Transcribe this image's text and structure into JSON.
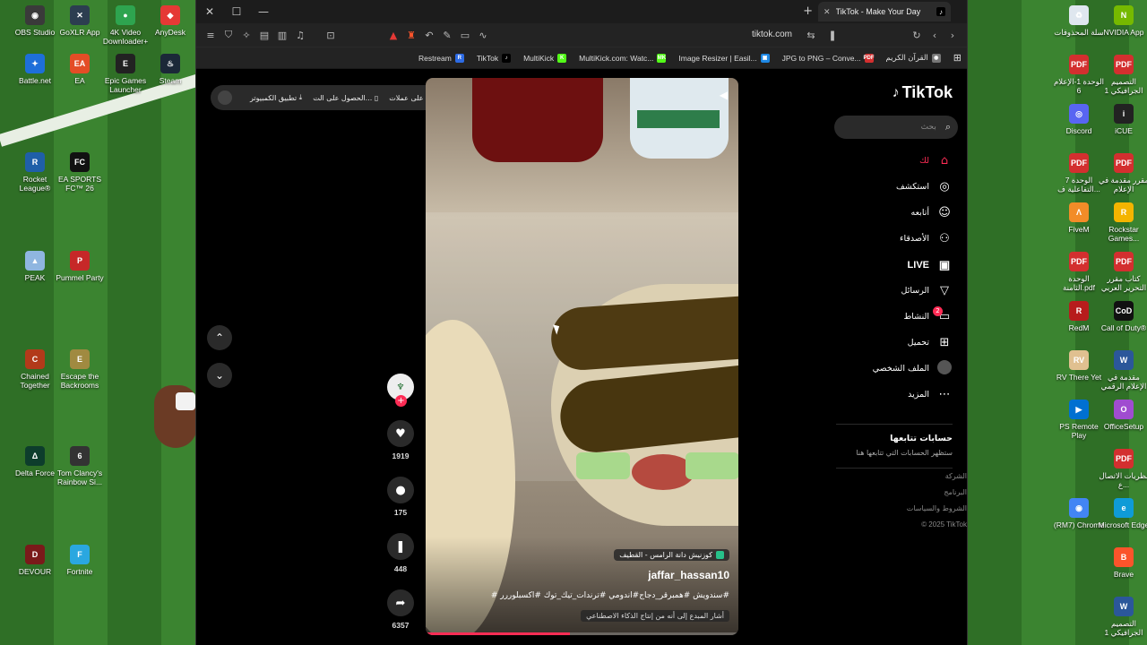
{
  "desktop": {
    "left_icons": [
      {
        "label": "OBS Studio",
        "name": "obs-studio-icon",
        "color": "#3a3a3a",
        "glyph": "◉"
      },
      {
        "label": "GoXLR App",
        "name": "goxlr-icon",
        "color": "#2c3e50",
        "glyph": "✕"
      },
      {
        "label": "4K Video Downloader+",
        "name": "4k-video-downloader-icon",
        "color": "#2ea44f",
        "glyph": "●"
      },
      {
        "label": "AnyDesk",
        "name": "anydesk-icon",
        "color": "#e53935",
        "glyph": "◆"
      },
      {
        "label": "Battle.net",
        "name": "battlenet-icon",
        "color": "#1e6fd9",
        "glyph": "✦"
      },
      {
        "label": "EA",
        "name": "ea-icon",
        "color": "#e44d26",
        "glyph": "EA"
      },
      {
        "label": "Epic Games Launcher",
        "name": "epic-games-icon",
        "color": "#222",
        "glyph": "E"
      },
      {
        "label": "Steam",
        "name": "steam-icon",
        "color": "#1b2838",
        "glyph": "♨"
      },
      {
        "label": "Rocket League®",
        "name": "rocket-league-icon",
        "color": "#1f5fa8",
        "glyph": "R"
      },
      {
        "label": "EA SPORTS FC™ 26",
        "name": "ea-sports-fc-icon",
        "color": "#111",
        "glyph": "FC"
      },
      {
        "label": "PEAK",
        "name": "peak-icon",
        "color": "#8fb6e0",
        "glyph": "▲"
      },
      {
        "label": "Pummel Party",
        "name": "pummel-party-icon",
        "color": "#c62828",
        "glyph": "P"
      },
      {
        "label": "Chained Together",
        "name": "chained-together-icon",
        "color": "#b23a1a",
        "glyph": "C"
      },
      {
        "label": "Escape the Backrooms",
        "name": "escape-backrooms-icon",
        "color": "#a08a40",
        "glyph": "E"
      },
      {
        "label": "Delta Force",
        "name": "delta-force-icon",
        "color": "#0d3d2c",
        "glyph": "Δ"
      },
      {
        "label": "Tom Clancy's Rainbow Si...",
        "name": "rainbow-six-icon",
        "color": "#333",
        "glyph": "6"
      },
      {
        "label": "DEVOUR",
        "name": "devour-icon",
        "color": "#7a1a1a",
        "glyph": "D"
      },
      {
        "label": "Fortnite",
        "name": "fortnite-icon",
        "color": "#2aa7e0",
        "glyph": "F"
      }
    ],
    "right_icons": [
      {
        "label": "سلة المحذوفات",
        "name": "recycle-bin-icon",
        "color": "#dfe7ef",
        "glyph": "♻"
      },
      {
        "label": "NVIDIA App",
        "name": "nvidia-icon",
        "color": "#76b900",
        "glyph": "N"
      },
      {
        "label": "الوحدة 1-الإعلام 6",
        "name": "pdf-file-icon",
        "color": "#d32f2f",
        "glyph": "PDF"
      },
      {
        "label": "التصميم الجرافيكي 1",
        "name": "pdf-file-icon",
        "color": "#d32f2f",
        "glyph": "PDF"
      },
      {
        "label": "Discord",
        "name": "discord-icon",
        "color": "#5865f2",
        "glyph": "◎"
      },
      {
        "label": "iCUE",
        "name": "icue-icon",
        "color": "#222",
        "glyph": "i"
      },
      {
        "label": "الوحدة 7 التفاعلية ف...",
        "name": "pdf-file-icon",
        "color": "#d32f2f",
        "glyph": "PDF"
      },
      {
        "label": "مقرر مقدمة في الإعلام",
        "name": "pdf-file-icon",
        "color": "#d32f2f",
        "glyph": "PDF"
      },
      {
        "label": "FiveM",
        "name": "fivem-icon",
        "color": "#f28c28",
        "glyph": "Λ"
      },
      {
        "label": "Rockstar Games...",
        "name": "rockstar-icon",
        "color": "#f4b400",
        "glyph": "R"
      },
      {
        "label": "الوحدة الثامنة.pdf",
        "name": "pdf-file-icon",
        "color": "#d32f2f",
        "glyph": "PDF"
      },
      {
        "label": "كتاب مقرر التحرير العربي",
        "name": "pdf-file-icon",
        "color": "#d32f2f",
        "glyph": "PDF"
      },
      {
        "label": "RedM",
        "name": "redm-icon",
        "color": "#b71c1c",
        "glyph": "R"
      },
      {
        "label": "Call of Duty®",
        "name": "call-of-duty-icon",
        "color": "#111",
        "glyph": "CoD"
      },
      {
        "label": "RV There Yet",
        "name": "rv-there-yet-icon",
        "color": "#e0c090",
        "glyph": "RV"
      },
      {
        "label": "مقدمة في الإعلام الرقمي",
        "name": "word-file-icon",
        "color": "#2b579a",
        "glyph": "W"
      },
      {
        "label": "PS Remote Play",
        "name": "ps-remote-play-icon",
        "color": "#0070d1",
        "glyph": "▶"
      },
      {
        "label": "OfficeSetup",
        "name": "office-setup-icon",
        "color": "#a04cd0",
        "glyph": "O"
      },
      {
        "label": "",
        "name": "blank-slot",
        "color": "transparent",
        "glyph": ""
      },
      {
        "label": "نظريات الاتصال ع...",
        "name": "pdf-file-icon",
        "color": "#d32f2f",
        "glyph": "PDF"
      },
      {
        "label": "(RM7) Chrome",
        "name": "chrome-icon",
        "color": "#4285f4",
        "glyph": "◉"
      },
      {
        "label": "Microsoft Edge",
        "name": "edge-icon",
        "color": "#0f9bd7",
        "glyph": "e"
      },
      {
        "label": "",
        "name": "blank-slot",
        "color": "transparent",
        "glyph": ""
      },
      {
        "label": "Brave",
        "name": "brave-icon",
        "color": "#fb542b",
        "glyph": "B"
      },
      {
        "label": "",
        "name": "blank-slot",
        "color": "transparent",
        "glyph": ""
      },
      {
        "label": "التصميم الجرافيكي 1",
        "name": "word-file-icon",
        "color": "#2b579a",
        "glyph": "W"
      }
    ]
  },
  "browser": {
    "tab_title": "TikTok - Make Your Day",
    "url": "tiktok.com",
    "bookmarks": [
      {
        "label": "Restream",
        "color": "#2d6be4",
        "glyph": "R"
      },
      {
        "label": "TikTok",
        "color": "#000000",
        "glyph": "♪"
      },
      {
        "label": "MultiKick",
        "color": "#53fc18",
        "glyph": "K"
      },
      {
        "label": "MultiKick.com: Watc...",
        "color": "#53fc18",
        "glyph": "MK"
      },
      {
        "label": "Image Resizer | Easil...",
        "color": "#1e88e5",
        "glyph": "▣"
      },
      {
        "label": "JPG to PNG – Conve...",
        "color": "#d32f2f",
        "glyph": "PDF"
      },
      {
        "label": "القرآن الكريم",
        "color": "#777777",
        "glyph": "◉"
      }
    ]
  },
  "tiktok": {
    "logo": "TikTok",
    "search_placeholder": "بحث",
    "download_bar": {
      "item1": "تطبيق الكمبيوتر",
      "item2": "الحصول على الت...",
      "item3": "احصل على عملات"
    },
    "menu": [
      {
        "label": "لك",
        "icon": "home-icon",
        "glyph": "⌂",
        "active": true,
        "name": "nav-for-you"
      },
      {
        "label": "استكشف",
        "icon": "compass-icon",
        "glyph": "◎",
        "active": false,
        "name": "nav-explore"
      },
      {
        "label": "أتابعه",
        "icon": "user-follow-icon",
        "glyph": "☺",
        "active": false,
        "name": "nav-following"
      },
      {
        "label": "الأصدقاء",
        "icon": "friends-icon",
        "glyph": "⚇",
        "active": false,
        "name": "nav-friends"
      },
      {
        "label": "LIVE",
        "icon": "live-tv-icon",
        "glyph": "▣",
        "active": false,
        "name": "nav-live"
      },
      {
        "label": "الرسائل",
        "icon": "send-icon",
        "glyph": "▽",
        "active": false,
        "name": "nav-messages"
      },
      {
        "label": "النشاط",
        "icon": "activity-icon",
        "glyph": "▭",
        "active": false,
        "name": "nav-activity",
        "badge": "2"
      },
      {
        "label": "تحميل",
        "icon": "upload-icon",
        "glyph": "⊞",
        "active": false,
        "name": "nav-upload"
      },
      {
        "label": "الملف الشخصي",
        "icon": "profile-avatar-icon",
        "glyph": "",
        "active": false,
        "name": "nav-profile"
      },
      {
        "label": "المزيد",
        "icon": "more-icon",
        "glyph": "⋯",
        "active": false,
        "name": "nav-more"
      }
    ],
    "following_section": {
      "heading": "حسابات تتابعها",
      "placeholder": "ستظهر الحسابات التي تتابعها هنا"
    },
    "footer": {
      "company": "الشركة",
      "program": "البرنامج",
      "terms": "الشروط والسياسات",
      "copyright": "© 2025 TikTok"
    },
    "video": {
      "location": "كوزنيش دانة الرامس - القطيف",
      "author": "jaffar_hassan10",
      "caption": "#سندويش #همبرقر_دجاج#اندومي #ترندات_تيك_توك #اكسبلوررر #",
      "ai_label": "أشار المبدع إلى أنه من إنتاج الذكاء الاصطناعي",
      "progress": 0.46
    },
    "actions": {
      "likes": "1919",
      "comments": "175",
      "saves": "448",
      "shares": "6357"
    }
  }
}
